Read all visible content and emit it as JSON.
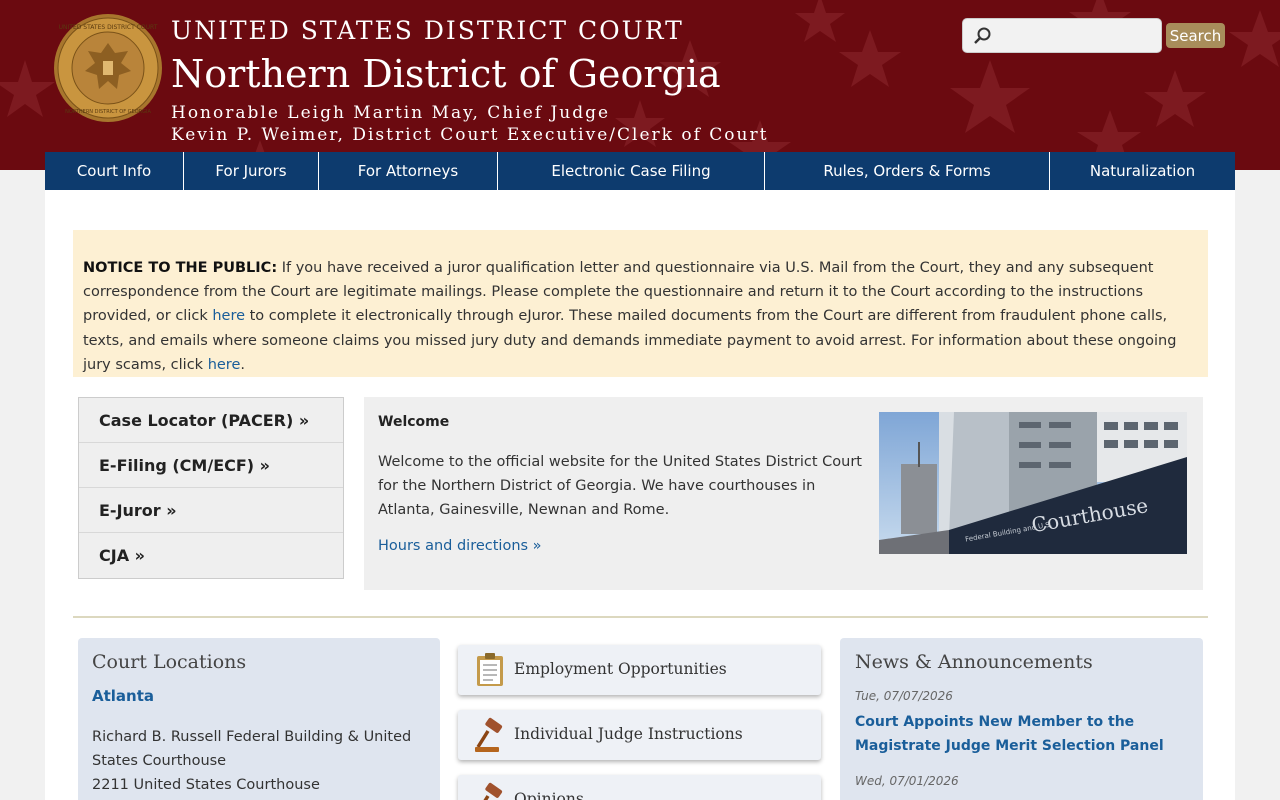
{
  "header": {
    "line1": "UNITED STATES DISTRICT COURT",
    "line2": "Northern District of Georgia",
    "line3": "Honorable Leigh Martin May, Chief Judge",
    "line4": "Kevin P. Weimer, District Court Executive/Clerk of Court",
    "seal_text_top": "UNITED STATES DISTRICT COURT",
    "seal_text_bottom": "NORTHERN DISTRICT OF GEORGIA"
  },
  "search": {
    "placeholder": "",
    "button_label": "Search",
    "icon": "search-icon"
  },
  "nav": [
    "Court Info",
    "For Jurors",
    "For Attorneys",
    "Electronic Case Filing",
    "Rules, Orders & Forms",
    "Naturalization"
  ],
  "notice": {
    "label": "NOTICE TO THE PUBLIC:",
    "text1": " If you have received a juror qualification letter and questionnaire via U.S. Mail from the Court, they and any subsequent correspondence from the Court are legitimate mailings. Please complete the questionnaire and return it to the Court according to the instructions provided, or click ",
    "link1": "here",
    "text2": " to complete it electronically through eJuror. These mailed documents from the Court are different from fraudulent phone calls, texts, and emails where someone claims you missed jury duty and demands immediate payment to avoid arrest. For information about these ongoing jury scams, click ",
    "link2": "here",
    "text3": "."
  },
  "quicklinks": [
    "Case Locator (PACER) »",
    "E-Filing (CM/ECF) »",
    "E-Juror »",
    "CJA »"
  ],
  "welcome": {
    "title": "Welcome",
    "text": "Welcome to the official website for the United States District Court for the Northern District of Georgia. We have courthouses in Atlanta, Gainesville, Newnan and Rome.",
    "link": "Hours and directions »",
    "photo_sign": "Richard B. Russell Federal Building and U.S. Courthouse"
  },
  "locations": {
    "title": "Court Locations",
    "city": "Atlanta",
    "address_line1": "Richard B. Russell Federal Building & United States Courthouse",
    "address_line2": "2211 United States Courthouse"
  },
  "tiles": [
    {
      "label": "Employment Opportunities",
      "icon": "clipboard-icon"
    },
    {
      "label": "Individual Judge Instructions",
      "icon": "gavel-icon"
    },
    {
      "label": "Opinions",
      "icon": "gavel-icon"
    }
  ],
  "news": {
    "title": "News & Announcements",
    "items": [
      {
        "date": "Tue, 07/07/2026",
        "headline": "Court Appoints New Member to the Magistrate Judge Merit Selection Panel"
      },
      {
        "date": "Wed, 07/01/2026",
        "headline": ""
      }
    ]
  },
  "colors": {
    "header_bg": "#6b0a10",
    "nav_bg": "#0d3b6e",
    "link": "#1a5e9a",
    "notice_bg": "#fdf0d3",
    "search_button": "#a88d5b"
  }
}
